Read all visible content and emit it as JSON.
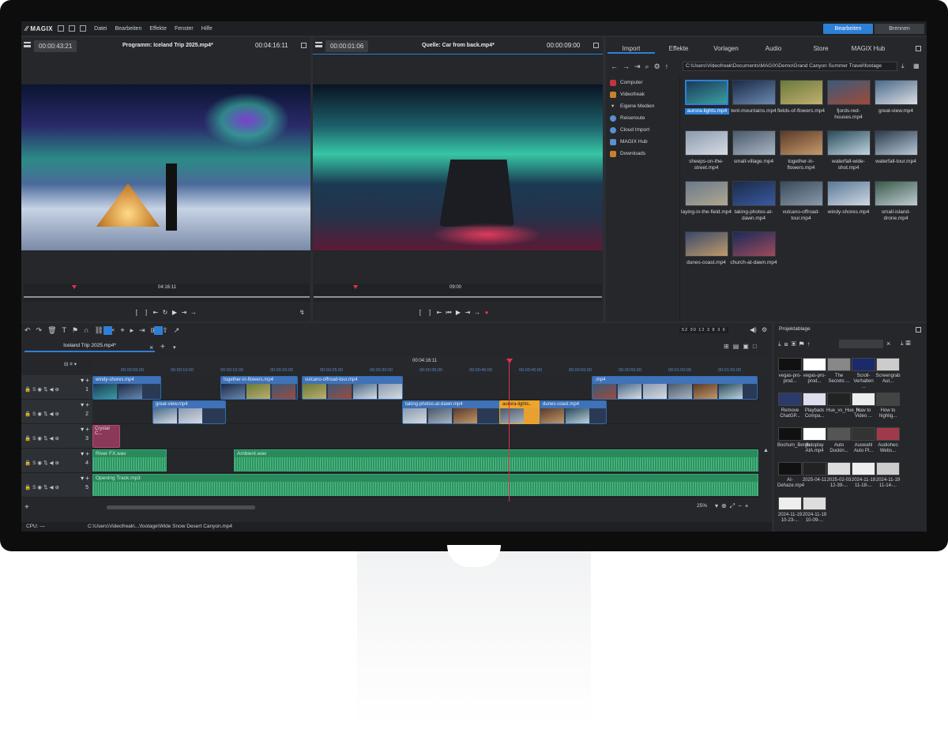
{
  "menu": {
    "logo": "MAGIX",
    "items": [
      "Datei",
      "Bearbeiten",
      "Effekte",
      "Fenster",
      "Hilfe"
    ],
    "mode_edit": "Bearbeiten",
    "mode_burn": "Brennen"
  },
  "program": {
    "timecode": "00:00:43:21",
    "title": "Programm: Iceland Trip 2025.mp4*",
    "duration": "00:04:16:11",
    "pos": "04:16:11"
  },
  "source": {
    "timecode": "00:00:01:06",
    "title": "Quelle: Car from back.mp4*",
    "duration": "00:00:09:00",
    "pos": "09:00"
  },
  "media": {
    "tabs": [
      "Import",
      "Effekte",
      "Vorlagen",
      "Audio",
      "Store",
      "MAGIX Hub"
    ],
    "path": "C:\\Users\\Videofreak\\Documents\\MAGIX\\Demo\\Grand Canyon Summer Travel\\footage",
    "tree": [
      {
        "label": "Computer",
        "color": "#c0353e"
      },
      {
        "label": "Videofreak",
        "color": "#c8812c"
      },
      {
        "label": "Eigene Medien",
        "color": ""
      },
      {
        "label": "Reiseroute",
        "color": "#5a8fd0"
      },
      {
        "label": "Cloud Import",
        "color": "#5a8fd0"
      },
      {
        "label": "MAGIX Hub",
        "color": "#5a8fd0"
      },
      {
        "label": "Downloads",
        "color": "#c8812c"
      }
    ],
    "files": [
      "aurora-lights.mp4",
      "tent-mountains.mp4",
      "fields-of-flowers.mp4",
      "fjords-red-houses.mp4",
      "great-view.mp4",
      "sheeps-on-the-street.mp4",
      "small-village.mp4",
      "together-in-flowers.mp4",
      "waterfall-wide-shot.mp4",
      "waterfall-tour.mp4",
      "laying-in-the-field.mp4",
      "taking-photos-at-dawn.mp4",
      "vulcano-offroad-tour.mp4",
      "windy-shores.mp4",
      "small-island-drone.mp4",
      "dunes-coast.mp4",
      "church-at-dawn.mp4"
    ]
  },
  "timeline": {
    "tab": "Iceland Trip 2025.mp4*",
    "playhead": "00:04:16:11",
    "zoom": "25%",
    "ruler": [
      "00:00:05:00",
      "00:00:10:00",
      "00:00:15:00",
      "00:00:20:00",
      "00:00:25:00",
      "00:00:30:00",
      "00:00:35:00",
      "00:00:40:00",
      "00:00:45:00",
      "00:00:50:00",
      "00:00:55:00",
      "00:01:00:00",
      "00:01:05:00"
    ],
    "scale": [
      "52",
      "30",
      "12",
      "3",
      "8",
      "3",
      "6"
    ],
    "video_clips": [
      {
        "label": "windy-shores.mp4"
      },
      {
        "label": "together-in-flowers.mp4"
      },
      {
        "label": "vulcano-offroad-tour.mp4"
      },
      {
        "label": ".mp4"
      },
      {
        "label": "great-view.mp4"
      },
      {
        "label": "taking-photos-at-dawn.mp4"
      },
      {
        "label": "aurora-lights.."
      },
      {
        "label": "dunes-coast.mp4"
      }
    ],
    "title_clip": "Crystal C...",
    "audio_clips": [
      "River FX.wav",
      "Ambient.wav",
      "Opening Track.mp3"
    ],
    "tracks": [
      "1",
      "2",
      "3",
      "4",
      "5"
    ]
  },
  "status": {
    "cpu": "CPU: —",
    "path": "C:\\Users\\Videofreak\\...\\footage\\Wide Snow Desert Canyon.mp4"
  },
  "project": {
    "title": "Projektablage",
    "items": [
      "vegas-pro-prod...",
      "vegas-pro-prod...",
      "The Secrets ...",
      "Scroll-Verhalten ...",
      "Screengrab Aut...",
      "Remove ChatGP...",
      "Playback Compa...",
      "Hue_vs_Hue_fr...",
      "How to Video ...",
      "How to highlig...",
      "Bochum_Bergb...",
      "Autoplay AIA.mp4",
      "Auto Duckin...",
      "Auswahl Auto Pl...",
      "Audioheo Webs...",
      "AI-Dehaze.mp4",
      "2025-04-11",
      "2025-02-03 12-39-...",
      "2024-11-19 11-18-...",
      "2024-11-19 11-14-...",
      "2024-11-19 10-23-...",
      "2024-11-19 10-09-..."
    ]
  }
}
